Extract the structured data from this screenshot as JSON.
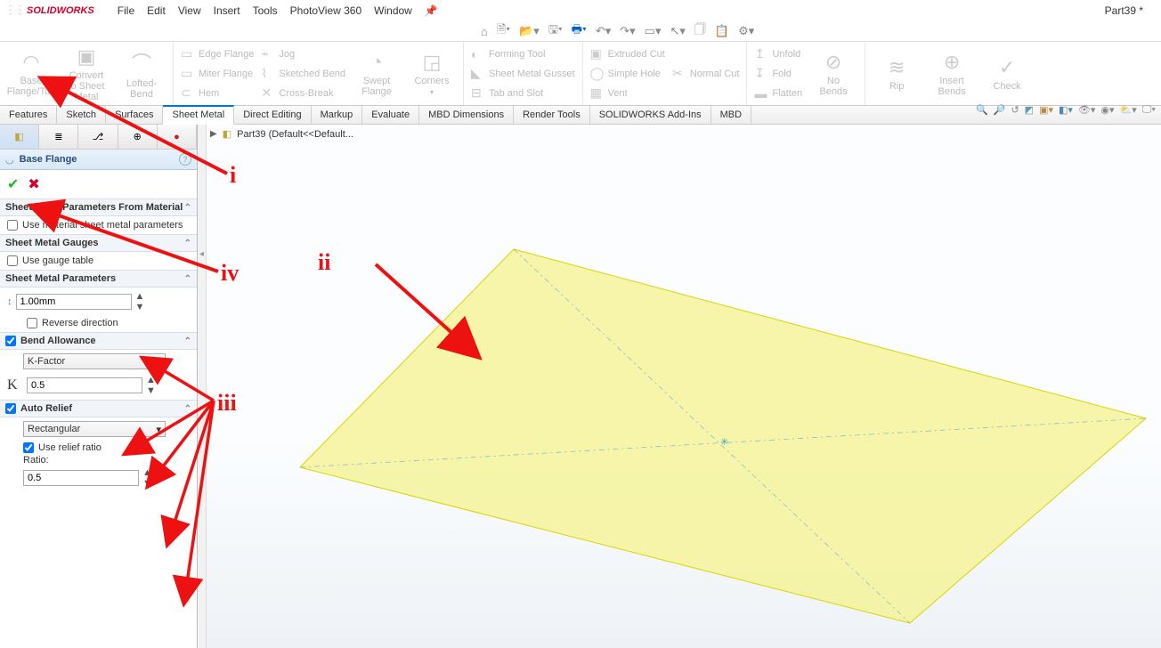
{
  "app": {
    "name": "SOLIDWORKS",
    "doc_title": "Part39 *"
  },
  "menu": [
    "File",
    "Edit",
    "View",
    "Insert",
    "Tools",
    "PhotoView 360",
    "Window"
  ],
  "ribbon": {
    "g1": [
      {
        "label": "Base\nFlange/Tab"
      },
      {
        "label": "Convert\nto Sheet\nMetal"
      },
      {
        "label": "Lofted-Bend"
      }
    ],
    "g2col1": [
      "Edge Flange",
      "Miter Flange",
      "Hem"
    ],
    "g2col2": [
      "Jog",
      "Sketched Bend",
      "Cross-Break"
    ],
    "g2big": [
      "Swept\nFlange",
      "Corners"
    ],
    "g3": [
      "Forming Tool",
      "Sheet Metal Gusset",
      "Tab and Slot"
    ],
    "g4": [
      "Extruded Cut",
      "Simple Hole",
      "Vent"
    ],
    "g4a": [
      "Normal Cut"
    ],
    "g5": [
      "Unfold",
      "Fold",
      "Flatten"
    ],
    "g5big": [
      "No\nBends"
    ],
    "g6": [
      "Rip",
      "Insert\nBends",
      "Check"
    ]
  },
  "cm_tabs": [
    "Features",
    "Sketch",
    "Surfaces",
    "Sheet Metal",
    "Direct Editing",
    "Markup",
    "Evaluate",
    "MBD Dimensions",
    "Render Tools",
    "SOLIDWORKS Add-Ins",
    "MBD"
  ],
  "cm_active": "Sheet Metal",
  "breadcrumb": "Part39  (Default<<Default...",
  "pm": {
    "title": "Base Flange",
    "s1_title": "Sheet Metal Parameters From Material",
    "s1_chk": "Use material sheet metal parameters",
    "s2_title": "Sheet Metal Gauges",
    "s2_chk": "Use gauge table",
    "s3_title": "Sheet Metal Parameters",
    "s3_thickness": "1.00mm",
    "s3_rev": "Reverse direction",
    "s4_title": "Bend Allowance",
    "s4_type": "K-Factor",
    "s4_k": "0.5",
    "s5_title": "Auto Relief",
    "s5_type": "Rectangular",
    "s5_chk": "Use relief ratio",
    "s5_ratio_lbl": "Ratio:",
    "s5_ratio": "0.5"
  },
  "annotations": {
    "i": "i",
    "ii": "ii",
    "iii": "iii",
    "iv": "iv"
  }
}
